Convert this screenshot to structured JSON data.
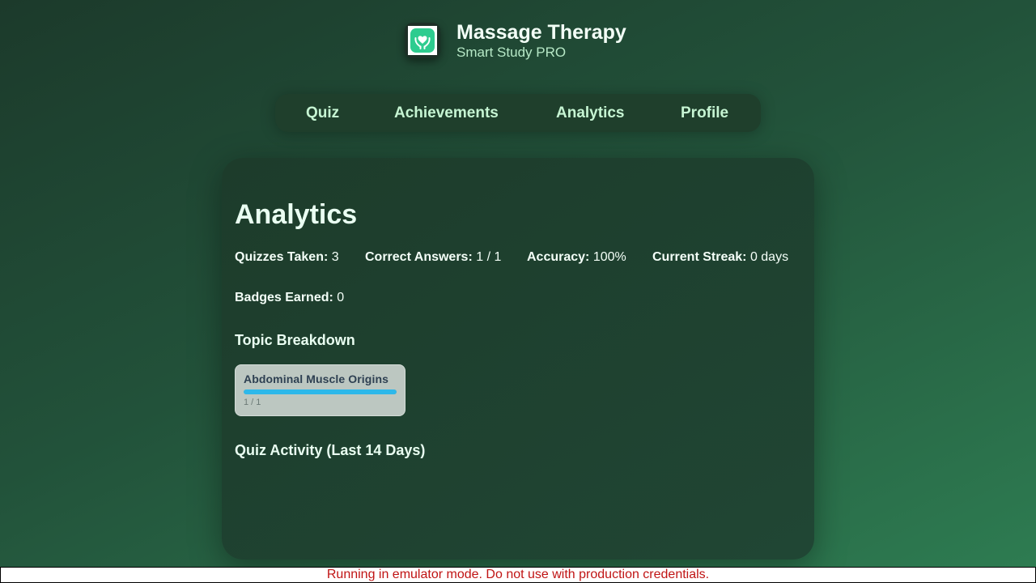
{
  "app": {
    "title": "Massage Therapy",
    "subtitle": "Smart Study PRO",
    "logo_icon": "hands-heart-icon",
    "accent": "#2ecc8f"
  },
  "nav": {
    "items": [
      {
        "label": "Quiz"
      },
      {
        "label": "Achievements"
      },
      {
        "label": "Analytics"
      },
      {
        "label": "Profile"
      }
    ]
  },
  "analytics": {
    "title": "Analytics",
    "stats": {
      "quizzes_taken_label": "Quizzes Taken:",
      "quizzes_taken_value": "3",
      "correct_label": "Correct Answers:",
      "correct_value": "1 / 1",
      "accuracy_label": "Accuracy:",
      "accuracy_value": "100%",
      "streak_label": "Current Streak:",
      "streak_value": "0 days",
      "badges_label": "Badges Earned:",
      "badges_value": "0"
    },
    "topic_breakdown": {
      "heading": "Topic Breakdown",
      "topics": [
        {
          "name": "Abdominal Muscle Origins",
          "count": "1 / 1",
          "progress": 1.0,
          "bar_color": "#2db8ea"
        }
      ]
    },
    "activity": {
      "heading": "Quiz Activity (Last 14 Days)"
    }
  },
  "banner": {
    "text": "Running in emulator mode. Do not use with production credentials.",
    "color": "#c01414"
  }
}
